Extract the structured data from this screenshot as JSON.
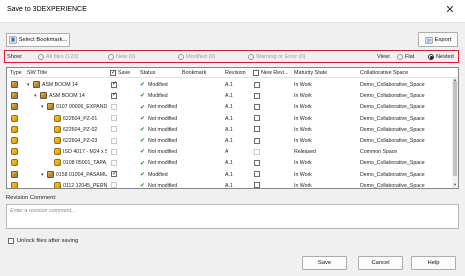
{
  "window": {
    "title": "Save to 3DEXPERIENCE"
  },
  "toolbar": {
    "select_bookmark": "Select Bookmark...",
    "export": "Export"
  },
  "filters": {
    "show_label": "Show:",
    "all_files": "All files (123)",
    "new": "New (0)",
    "modified": "Modified (0)",
    "warning": "Warning or Error (0)",
    "view_label": "View:",
    "flat": "Flat",
    "nested": "Nested",
    "selected_view": "Nested"
  },
  "columns": {
    "type": "Type",
    "sw_title": "SW Title",
    "save": "Save",
    "status": "Status",
    "bookmark": "Bookmark",
    "revision": "Revision",
    "new_revision": "New Revi...",
    "maturity": "Maturity State",
    "collab": "Collaborative Space"
  },
  "rows": [
    {
      "icon": "asm",
      "indent": 0,
      "expander": "▾",
      "title": "ASM BOOM 14",
      "save": "on",
      "status": "Modified",
      "status_ok": true,
      "revision": "A.1",
      "newrev": "off",
      "maturity": "In Work",
      "collab": "Demo_Collaborative_Space"
    },
    {
      "icon": "asm",
      "indent": 1,
      "expander": "▾",
      "title": "ASM BOOM 14",
      "save": "on",
      "status": "Modified",
      "status_ok": true,
      "revision": "A.1",
      "newrev": "off",
      "maturity": "In Work",
      "collab": "Demo_Collaborative_Space"
    },
    {
      "icon": "asm",
      "indent": 2,
      "expander": "▾",
      "title": "0107 00006_EXPANDER...",
      "save": "dis",
      "status": "Not modified",
      "status_ok": true,
      "revision": "A.1",
      "newrev": "off",
      "maturity": "In Work",
      "collab": "Demo_Collaborative_Space"
    },
    {
      "icon": "part",
      "indent": 3,
      "expander": "",
      "title": "622604_PZ-01",
      "save": "dis",
      "status": "Not modified",
      "status_ok": true,
      "revision": "A.1",
      "newrev": "off",
      "maturity": "In Work",
      "collab": "Demo_Collaborative_Space"
    },
    {
      "icon": "part",
      "indent": 3,
      "expander": "",
      "title": "622604_PZ-02",
      "save": "dis",
      "status": "Not modified",
      "status_ok": true,
      "revision": "A.1",
      "newrev": "off",
      "maturity": "In Work",
      "collab": "Demo_Collaborative_Space"
    },
    {
      "icon": "part",
      "indent": 3,
      "expander": "",
      "title": "622604_PZ-03",
      "save": "dis",
      "status": "Not modified",
      "status_ok": true,
      "revision": "A.1",
      "newrev": "off",
      "maturity": "In Work",
      "collab": "Demo_Collaborative_Space"
    },
    {
      "icon": "part",
      "indent": 3,
      "expander": "",
      "title": "ISO 4017 - M24 x 5...",
      "save": "dis",
      "status": "Not modified",
      "status_ok": true,
      "revision": "A",
      "newrev": "dis",
      "maturity": "Released",
      "collab": "Common Space"
    },
    {
      "icon": "part",
      "indent": 3,
      "expander": "",
      "title": "0108 05001_TAPA_120...",
      "save": "dis",
      "status": "Not modified",
      "status_ok": true,
      "revision": "A.1",
      "newrev": "off",
      "maturity": "In Work",
      "collab": "Demo_Collaborative_Space"
    },
    {
      "icon": "asm",
      "indent": 2,
      "expander": "▾",
      "title": "0158 01004_PASAMUR...",
      "save": "on",
      "status": "Modified",
      "status_ok": true,
      "revision": "A.1",
      "newrev": "off",
      "maturity": "In Work",
      "collab": "Demo_Collaborative_Space"
    },
    {
      "icon": "part",
      "indent": 3,
      "expander": "",
      "title": "0112 12045_PERN...",
      "save": "dis",
      "status": "Not modified",
      "status_ok": true,
      "revision": "A.1",
      "newrev": "off",
      "maturity": "In Work",
      "collab": "Demo_Collaborative_Space"
    }
  ],
  "comment": {
    "label": "Revision Comment:",
    "placeholder": "Enter a revision comment..."
  },
  "unlock": {
    "label": "Unlock files after saving",
    "checked": false
  },
  "footer": {
    "save": "Save",
    "cancel": "Cancel",
    "help": "Help"
  },
  "colors": {
    "highlight_border": "#d61f2c",
    "status_ok": "#218c2a"
  }
}
